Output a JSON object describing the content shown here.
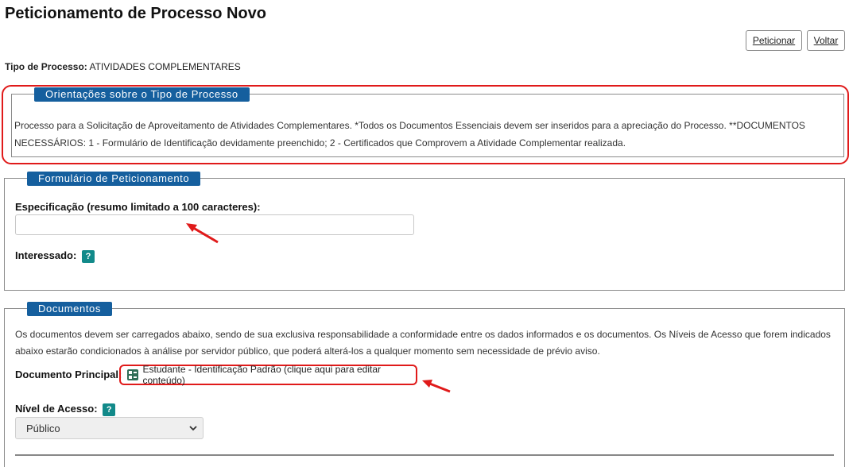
{
  "header": {
    "title": "Peticionamento de Processo Novo",
    "peticionar_label": "Peticionar",
    "voltar_label": "Voltar"
  },
  "tipo": {
    "label": "Tipo de Processo:",
    "value": "ATIVIDADES COMPLEMENTARES"
  },
  "orientacoes": {
    "legend": "Orientações sobre o Tipo de Processo",
    "text": "Processo para a Solicitação de Aproveitamento de Atividades Complementares. *Todos os Documentos Essenciais devem ser inseridos para a apreciação do Processo. **DOCUMENTOS NECESSÁRIOS: 1 - Formulário de Identificação devidamente preenchido; 2 - Certificados que Comprovem a Atividade Complementar realizada."
  },
  "formulario": {
    "legend": "Formulário de Peticionamento",
    "especificacao_label": "Especificação (resumo limitado a 100 caracteres):",
    "especificacao_value": "",
    "interessado_label": "Interessado:",
    "help_icon": "?"
  },
  "documentos": {
    "legend": "Documentos",
    "text": "Os documentos devem ser carregados abaixo, sendo de sua exclusiva responsabilidade a conformidade entre os dados informados e os documentos. Os Níveis de Acesso que forem indicados abaixo estarão condicionados à análise por servidor público, que poderá alterá-los a qualquer momento sem necessidade de prévio aviso.",
    "principal_label": "Documento Principal:",
    "principal_link": "Estudante - Identificação Padrão (clique aqui para editar conteúdo)",
    "nivel_label": "Nível de Acesso:",
    "nivel_selected": "Público"
  },
  "colors": {
    "legend_bg": "#155f9e",
    "help_bg": "#128a8a",
    "highlight": "#e01a1a"
  }
}
